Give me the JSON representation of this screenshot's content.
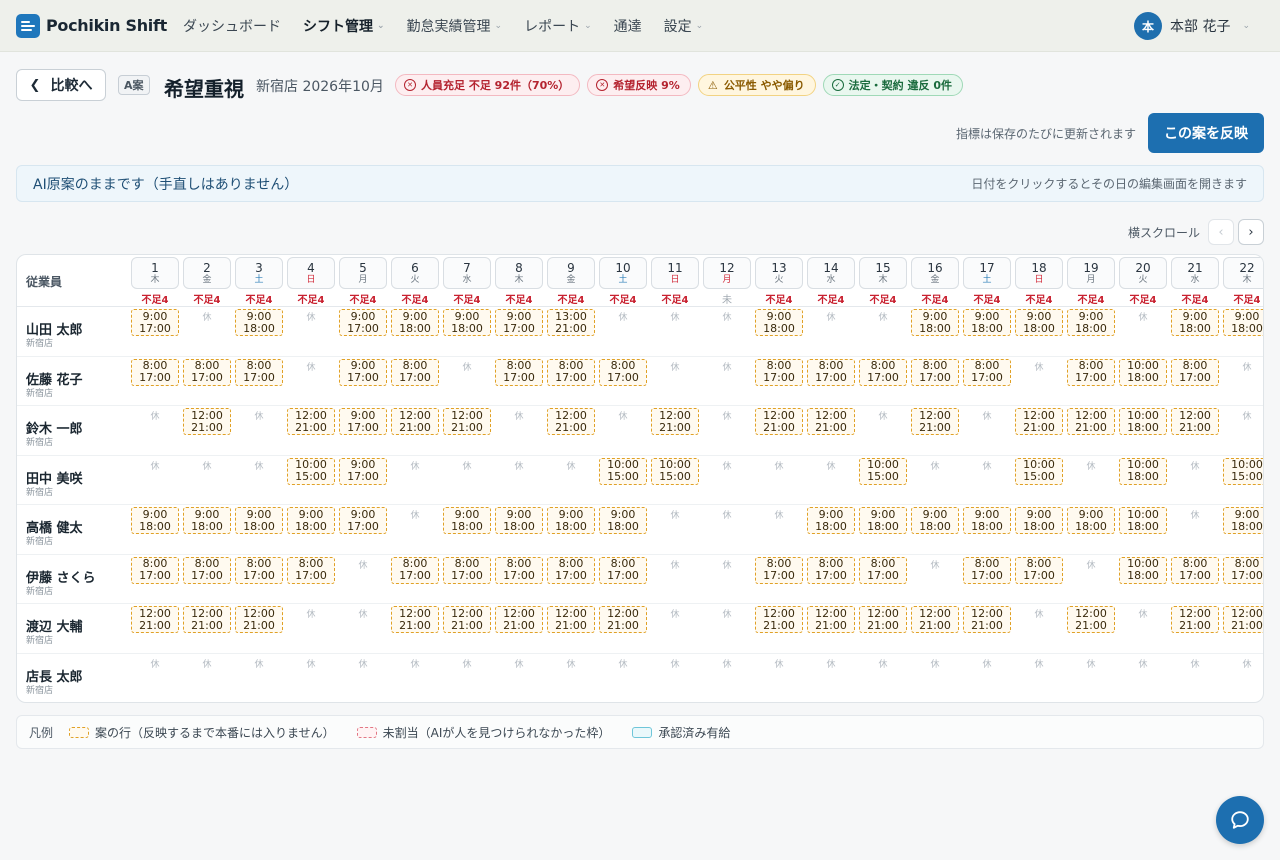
{
  "app": {
    "name": "Pochikin Shift"
  },
  "nav": [
    {
      "label": "ダッシュボード",
      "caret": false,
      "active": false
    },
    {
      "label": "シフト管理",
      "caret": true,
      "active": true
    },
    {
      "label": "勤怠実績管理",
      "caret": true,
      "active": false
    },
    {
      "label": "レポート",
      "caret": true,
      "active": false
    },
    {
      "label": "通達",
      "caret": false,
      "active": false
    },
    {
      "label": "設定",
      "caret": true,
      "active": false
    }
  ],
  "user": {
    "avatar": "本",
    "name": "本部 花子"
  },
  "header": {
    "back_label": "比較へ",
    "plan_badge": "A案",
    "plan_title": "希望重視",
    "plan_sub": "新宿店 2026年10月",
    "chips": [
      {
        "icon": "x-circle-icon",
        "glyph": "✕",
        "text": "人員充足 不足 92件（70%）",
        "tone": "red"
      },
      {
        "icon": "x-circle-icon",
        "glyph": "✕",
        "text": "希望反映 9%",
        "tone": "red"
      },
      {
        "icon": "warning-icon",
        "glyph": "⚠",
        "text": "公平性 やや偏り",
        "tone": "amber"
      },
      {
        "icon": "check-circle-icon",
        "glyph": "✓",
        "text": "法定・契約 違反 0件",
        "tone": "green"
      }
    ],
    "update_note": "指標は保存のたびに更新されます",
    "apply_label": "この案を反映"
  },
  "info_bar": {
    "left": "AI原案のままです（手直しはありません）",
    "right": "日付をクリックするとその日の編集画面を開きます"
  },
  "hscroll": {
    "label": "横スクロール",
    "prev": "‹",
    "next": "›"
  },
  "grid": {
    "employee_header": "従業員",
    "days": [
      {
        "d": "1",
        "w": "木",
        "k": "",
        "short": "不足4"
      },
      {
        "d": "2",
        "w": "金",
        "k": "",
        "short": "不足4"
      },
      {
        "d": "3",
        "w": "土",
        "k": "sat",
        "short": "不足4"
      },
      {
        "d": "4",
        "w": "日",
        "k": "sun",
        "short": "不足4"
      },
      {
        "d": "5",
        "w": "月",
        "k": "",
        "short": "不足4"
      },
      {
        "d": "6",
        "w": "火",
        "k": "",
        "short": "不足4"
      },
      {
        "d": "7",
        "w": "水",
        "k": "",
        "short": "不足4"
      },
      {
        "d": "8",
        "w": "木",
        "k": "",
        "short": "不足4"
      },
      {
        "d": "9",
        "w": "金",
        "k": "",
        "short": "不足4"
      },
      {
        "d": "10",
        "w": "土",
        "k": "sat",
        "short": "不足4"
      },
      {
        "d": "11",
        "w": "日",
        "k": "sun",
        "short": "不足4"
      },
      {
        "d": "12",
        "w": "月",
        "k": "sun",
        "short": "未"
      },
      {
        "d": "13",
        "w": "火",
        "k": "",
        "short": "不足4"
      },
      {
        "d": "14",
        "w": "水",
        "k": "",
        "short": "不足4"
      },
      {
        "d": "15",
        "w": "木",
        "k": "",
        "short": "不足4"
      },
      {
        "d": "16",
        "w": "金",
        "k": "",
        "short": "不足4"
      },
      {
        "d": "17",
        "w": "土",
        "k": "sat",
        "short": "不足4"
      },
      {
        "d": "18",
        "w": "日",
        "k": "sun",
        "short": "不足4"
      },
      {
        "d": "19",
        "w": "月",
        "k": "",
        "short": "不足4"
      },
      {
        "d": "20",
        "w": "火",
        "k": "",
        "short": "不足4"
      },
      {
        "d": "21",
        "w": "水",
        "k": "",
        "short": "不足4"
      },
      {
        "d": "22",
        "w": "木",
        "k": "",
        "short": "不足4"
      }
    ],
    "off_label": "休",
    "employees": [
      {
        "name": "山田 太郎",
        "store": "新宿店",
        "cells": [
          [
            "9:00",
            "17:00"
          ],
          null,
          [
            "9:00",
            "18:00"
          ],
          null,
          [
            "9:00",
            "17:00"
          ],
          [
            "9:00",
            "18:00"
          ],
          [
            "9:00",
            "18:00"
          ],
          [
            "9:00",
            "17:00"
          ],
          [
            "13:00",
            "21:00"
          ],
          null,
          null,
          null,
          [
            "9:00",
            "18:00"
          ],
          null,
          null,
          [
            "9:00",
            "18:00"
          ],
          [
            "9:00",
            "18:00"
          ],
          [
            "9:00",
            "18:00"
          ],
          [
            "9:00",
            "18:00"
          ],
          null,
          [
            "9:00",
            "18:00"
          ],
          [
            "9:00",
            "18:00"
          ]
        ]
      },
      {
        "name": "佐藤 花子",
        "store": "新宿店",
        "cells": [
          [
            "8:00",
            "17:00"
          ],
          [
            "8:00",
            "17:00"
          ],
          [
            "8:00",
            "17:00"
          ],
          null,
          [
            "9:00",
            "17:00"
          ],
          [
            "8:00",
            "17:00"
          ],
          null,
          [
            "8:00",
            "17:00"
          ],
          [
            "8:00",
            "17:00"
          ],
          [
            "8:00",
            "17:00"
          ],
          null,
          null,
          [
            "8:00",
            "17:00"
          ],
          [
            "8:00",
            "17:00"
          ],
          [
            "8:00",
            "17:00"
          ],
          [
            "8:00",
            "17:00"
          ],
          [
            "8:00",
            "17:00"
          ],
          null,
          [
            "8:00",
            "17:00"
          ],
          [
            "10:00",
            "18:00"
          ],
          [
            "8:00",
            "17:00"
          ],
          null
        ]
      },
      {
        "name": "鈴木 一郎",
        "store": "新宿店",
        "cells": [
          null,
          [
            "12:00",
            "21:00"
          ],
          null,
          [
            "12:00",
            "21:00"
          ],
          [
            "9:00",
            "17:00"
          ],
          [
            "12:00",
            "21:00"
          ],
          [
            "12:00",
            "21:00"
          ],
          null,
          [
            "12:00",
            "21:00"
          ],
          null,
          [
            "12:00",
            "21:00"
          ],
          null,
          [
            "12:00",
            "21:00"
          ],
          [
            "12:00",
            "21:00"
          ],
          null,
          [
            "12:00",
            "21:00"
          ],
          null,
          [
            "12:00",
            "21:00"
          ],
          [
            "12:00",
            "21:00"
          ],
          [
            "10:00",
            "18:00"
          ],
          [
            "12:00",
            "21:00"
          ],
          null
        ]
      },
      {
        "name": "田中 美咲",
        "store": "新宿店",
        "cells": [
          null,
          null,
          null,
          [
            "10:00",
            "15:00"
          ],
          [
            "9:00",
            "17:00"
          ],
          null,
          null,
          null,
          null,
          [
            "10:00",
            "15:00"
          ],
          [
            "10:00",
            "15:00"
          ],
          null,
          null,
          null,
          [
            "10:00",
            "15:00"
          ],
          null,
          null,
          [
            "10:00",
            "15:00"
          ],
          null,
          [
            "10:00",
            "18:00"
          ],
          null,
          [
            "10:00",
            "15:00"
          ]
        ]
      },
      {
        "name": "高橋 健太",
        "store": "新宿店",
        "cells": [
          [
            "9:00",
            "18:00"
          ],
          [
            "9:00",
            "18:00"
          ],
          [
            "9:00",
            "18:00"
          ],
          [
            "9:00",
            "18:00"
          ],
          [
            "9:00",
            "17:00"
          ],
          null,
          [
            "9:00",
            "18:00"
          ],
          [
            "9:00",
            "18:00"
          ],
          [
            "9:00",
            "18:00"
          ],
          [
            "9:00",
            "18:00"
          ],
          null,
          null,
          null,
          [
            "9:00",
            "18:00"
          ],
          [
            "9:00",
            "18:00"
          ],
          [
            "9:00",
            "18:00"
          ],
          [
            "9:00",
            "18:00"
          ],
          [
            "9:00",
            "18:00"
          ],
          [
            "9:00",
            "18:00"
          ],
          [
            "10:00",
            "18:00"
          ],
          null,
          [
            "9:00",
            "18:00"
          ]
        ]
      },
      {
        "name": "伊藤 さくら",
        "store": "新宿店",
        "cells": [
          [
            "8:00",
            "17:00"
          ],
          [
            "8:00",
            "17:00"
          ],
          [
            "8:00",
            "17:00"
          ],
          [
            "8:00",
            "17:00"
          ],
          null,
          [
            "8:00",
            "17:00"
          ],
          [
            "8:00",
            "17:00"
          ],
          [
            "8:00",
            "17:00"
          ],
          [
            "8:00",
            "17:00"
          ],
          [
            "8:00",
            "17:00"
          ],
          null,
          null,
          [
            "8:00",
            "17:00"
          ],
          [
            "8:00",
            "17:00"
          ],
          [
            "8:00",
            "17:00"
          ],
          null,
          [
            "8:00",
            "17:00"
          ],
          [
            "8:00",
            "17:00"
          ],
          null,
          [
            "10:00",
            "18:00"
          ],
          [
            "8:00",
            "17:00"
          ],
          [
            "8:00",
            "17:00"
          ]
        ]
      },
      {
        "name": "渡辺 大輔",
        "store": "新宿店",
        "cells": [
          [
            "12:00",
            "21:00"
          ],
          [
            "12:00",
            "21:00"
          ],
          [
            "12:00",
            "21:00"
          ],
          null,
          null,
          [
            "12:00",
            "21:00"
          ],
          [
            "12:00",
            "21:00"
          ],
          [
            "12:00",
            "21:00"
          ],
          [
            "12:00",
            "21:00"
          ],
          [
            "12:00",
            "21:00"
          ],
          null,
          null,
          [
            "12:00",
            "21:00"
          ],
          [
            "12:00",
            "21:00"
          ],
          [
            "12:00",
            "21:00"
          ],
          [
            "12:00",
            "21:00"
          ],
          [
            "12:00",
            "21:00"
          ],
          null,
          [
            "12:00",
            "21:00"
          ],
          null,
          [
            "12:00",
            "21:00"
          ],
          [
            "12:00",
            "21:00"
          ]
        ]
      },
      {
        "name": "店長 太郎",
        "store": "新宿店",
        "cells": [
          null,
          null,
          null,
          null,
          null,
          null,
          null,
          null,
          null,
          null,
          null,
          null,
          null,
          null,
          null,
          null,
          null,
          null,
          null,
          null,
          null,
          null
        ]
      }
    ]
  },
  "legend": {
    "title": "凡例",
    "items": [
      {
        "kind": "plan",
        "text": "案の行（反映するまで本番には入りません）"
      },
      {
        "kind": "unassigned",
        "text": "未割当（AIが人を見つけられなかった枠）"
      },
      {
        "kind": "leave",
        "text": "承認済み有給"
      }
    ]
  },
  "colors": {
    "primary": "#1d6fb0",
    "shortage": "#c8202f",
    "plan_border": "#e0a126"
  }
}
